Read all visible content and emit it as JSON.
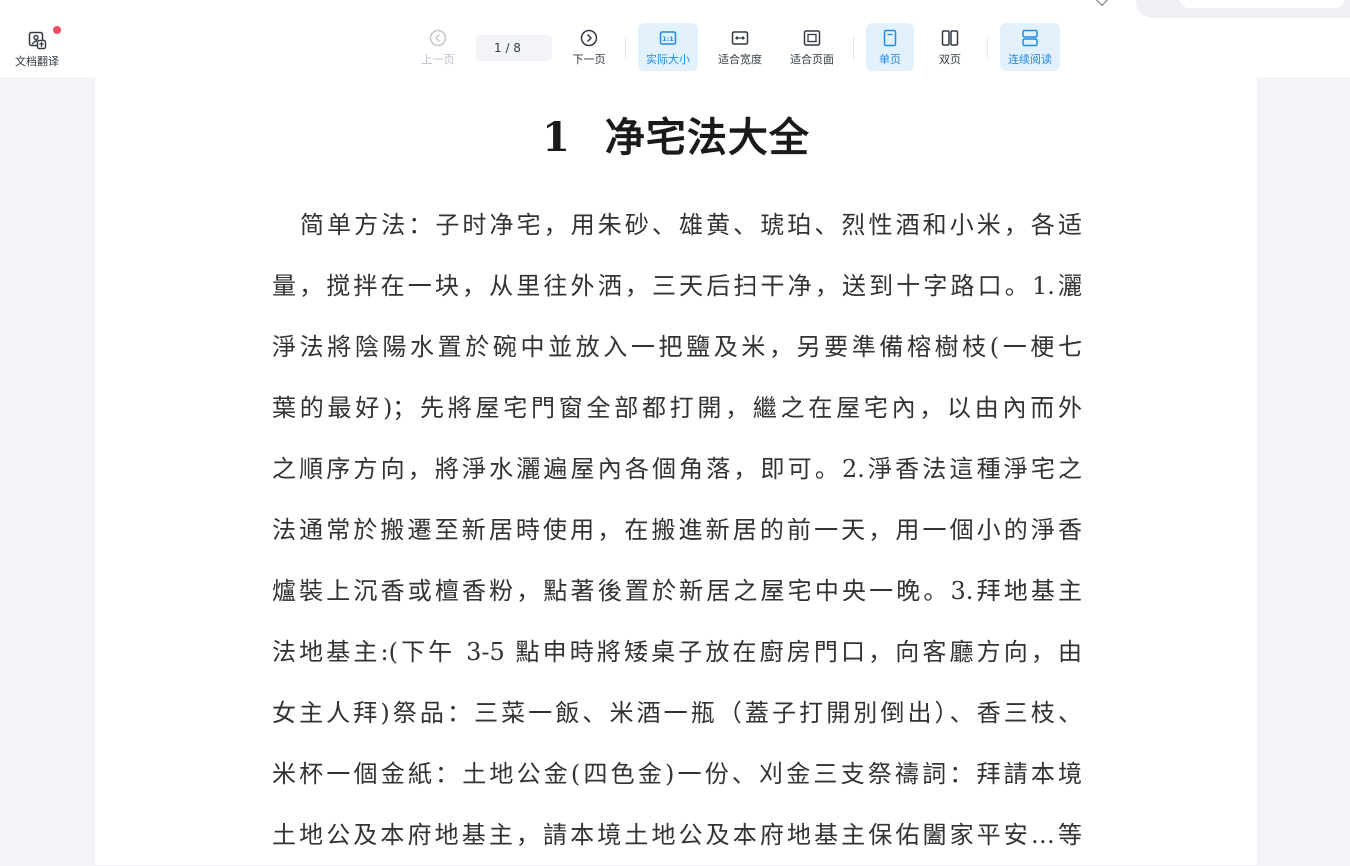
{
  "toolbar": {
    "translate_label": "文档翻译",
    "prev_label": "上一页",
    "page_indicator": "1  / 8",
    "next_label": "下一页",
    "actual_size_label": "实际大小",
    "fit_width_label": "适合宽度",
    "fit_page_label": "适合页面",
    "single_page_label": "单页",
    "double_page_label": "双页",
    "continuous_label": "连续阅读"
  },
  "document": {
    "title_number": "1",
    "title_text": "净宅法大全",
    "lines": [
      "简单方法：子时净宅，用朱砂、雄黄、琥珀、烈性酒和小米，各适",
      "量，搅拌在一块，从里往外洒，三天后扫干净，送到十字路口。1.灑",
      "淨法將陰陽水置於碗中並放入一把鹽及米，另要準備榕樹枝(一梗七",
      "葉的最好)；先將屋宅門窗全部都打開，繼之在屋宅內，以由內而外",
      "之順序方向，將淨水灑遍屋內各個角落，即可。2.淨香法這種淨宅之",
      "法通常於搬遷至新居時使用，在搬進新居的前一天，用一個小的淨香",
      "爐裝上沉香或檀香粉，點著後置於新居之屋宅中央一晚。3.拜地基主",
      "法地基主:(下午 3-5 點申時將矮桌子放在廚房門口，向客廳方向，由",
      "女主人拜)祭品：三菜一飯、米酒一瓶（蓋子打開別倒出）、香三枝、",
      "米杯一個金紙：土地公金(四色金)一份、刈金三支祭禱詞：拜請本境",
      "土地公及本府地基主，請本境土地公及本府地基主保佑闔家平安…等"
    ]
  },
  "colors": {
    "accent": "#1c8ce6",
    "active_bg": "#e3f1fc",
    "notification_dot": "#f04a64"
  }
}
